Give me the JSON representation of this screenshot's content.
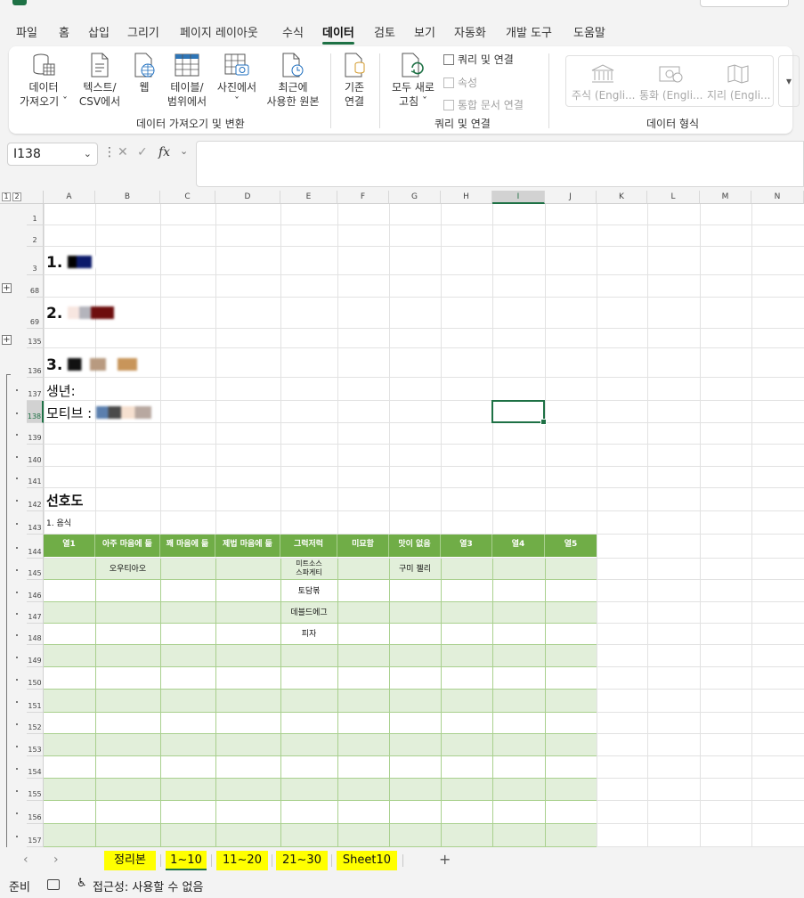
{
  "menu": {
    "tabs": [
      "파일",
      "홈",
      "삽입",
      "그리기",
      "페이지 레이아웃",
      "수식",
      "데이터",
      "검토",
      "보기",
      "자동화",
      "개발 도구",
      "도움말"
    ],
    "active": "데이터"
  },
  "ribbon": {
    "get_data": {
      "buttons": [
        {
          "line1": "데이터",
          "line2": "가져오기 ˇ"
        },
        {
          "line1": "텍스트/",
          "line2": "CSV에서"
        },
        {
          "line1": "웹",
          "line2": ""
        },
        {
          "line1": "테이블/",
          "line2": "범위에서"
        },
        {
          "line1": "사진에서",
          "line2": "ˇ"
        },
        {
          "line1": "최근에",
          "line2": "사용한 원본"
        },
        {
          "line1": "기존",
          "line2": "연결"
        }
      ],
      "group_label": "데이터 가져오기 및 변환"
    },
    "queries": {
      "refresh_line1": "모두 새로",
      "refresh_line2": "고침 ˇ",
      "queries_connections": "쿼리 및 연결",
      "properties": "속성",
      "edit_links": "통합 문서 연결",
      "group_label": "쿼리 및 연결"
    },
    "data_types": {
      "items": [
        "주식 (Engli...",
        "통화 (Engli...",
        "지리 (Engli..."
      ],
      "group_label": "데이터 형식"
    }
  },
  "formula_bar": {
    "name_box": "I138",
    "fx": "fx",
    "value": ""
  },
  "outline_levels": [
    "1",
    "2"
  ],
  "columns": [
    "A",
    "B",
    "C",
    "D",
    "E",
    "F",
    "G",
    "H",
    "I",
    "J",
    "K",
    "L",
    "M",
    "N"
  ],
  "selected_column": "I",
  "rows": [
    "1",
    "2",
    "3",
    "68",
    "69",
    "135",
    "136",
    "137",
    "138",
    "139",
    "140",
    "141",
    "142",
    "143",
    "144",
    "145",
    "146",
    "147",
    "148",
    "149",
    "150",
    "151",
    "152",
    "153",
    "154",
    "155",
    "156",
    "157"
  ],
  "selected_row": "138",
  "cells": {
    "r3": "1.",
    "r69": "2.",
    "r136": "3.",
    "r137": "생년:",
    "r138": "모티브 :",
    "r142": "선호도",
    "r143": "1. 음식"
  },
  "table": {
    "headers": [
      "열1",
      "아주 마음에 듦",
      "꽤 마음에 듦",
      "제법 마음에 듦",
      "그럭저럭",
      "미묘함",
      "맛이 없음",
      "열3",
      "열4",
      "열5"
    ],
    "cells": [
      {
        "row": "145",
        "col": "B",
        "text": "오우티아오"
      },
      {
        "row": "145",
        "col": "E",
        "line1": "미트소스",
        "line2": "스파게티"
      },
      {
        "row": "145",
        "col": "G",
        "text": "구미 젤리"
      },
      {
        "row": "146",
        "col": "E",
        "text": "토담볶"
      },
      {
        "row": "147",
        "col": "E",
        "text": "데블드에그"
      },
      {
        "row": "148",
        "col": "E",
        "text": "피자"
      }
    ],
    "band_colors": {
      "header": "#70ad47",
      "odd": "#e2efda",
      "even": "#ffffff",
      "border": "#a9d08e"
    }
  },
  "sheet_tabs": [
    "정리본",
    "1~10",
    "11~20",
    "21~30",
    "Sheet10"
  ],
  "active_sheet": "1~10",
  "status_bar": {
    "ready": "준비",
    "accessibility": "접근성: 사용할 수 없음"
  },
  "colors": {
    "accent": "#1e7145",
    "tab_highlight": "#ffff00"
  }
}
